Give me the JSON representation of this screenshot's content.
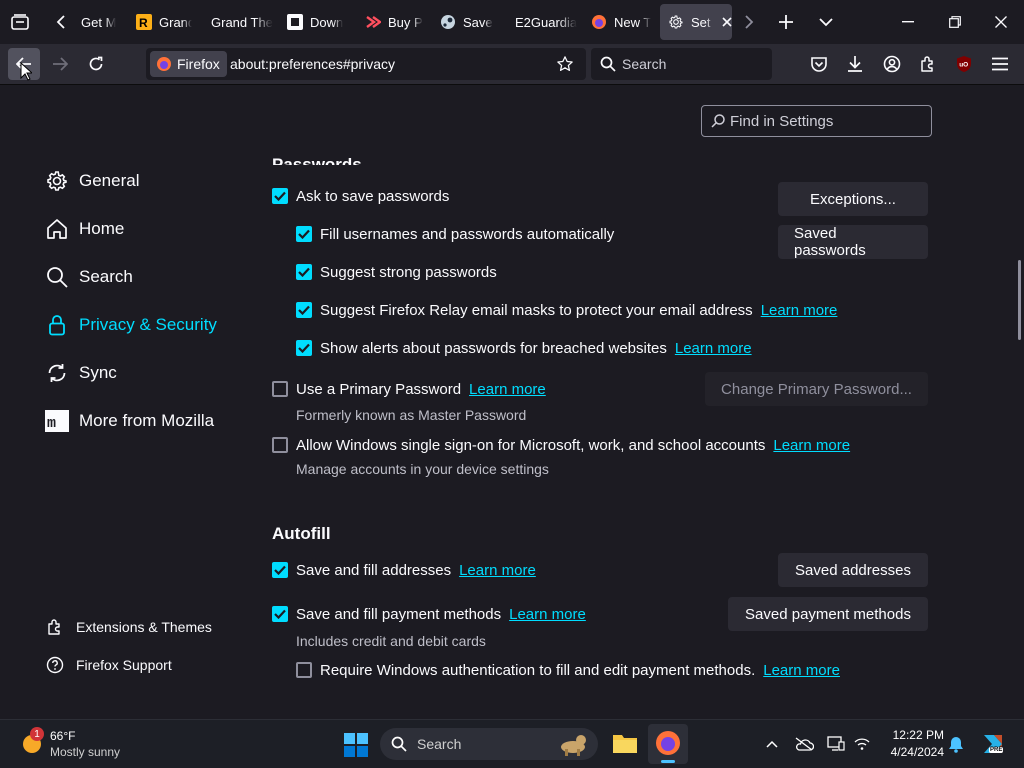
{
  "tabs": [
    {
      "title": "Get M",
      "icon": "mozilla-icon"
    },
    {
      "title": "Grand",
      "icon": "rockstar-icon"
    },
    {
      "title": "Grand The",
      "icon": "generic-page-icon"
    },
    {
      "title": "Down",
      "icon": "puzzle-site-icon"
    },
    {
      "title": "Buy P",
      "icon": "buy-site-icon"
    },
    {
      "title": "Save ",
      "icon": "steam-icon"
    },
    {
      "title": "E2Guardia",
      "icon": "generic-page-icon"
    },
    {
      "title": "New T",
      "icon": "firefox-icon"
    },
    {
      "title": "Set",
      "icon": "gear-icon",
      "active": true
    }
  ],
  "navbar": {
    "identity_label": "Firefox",
    "url": "about:preferences#privacy",
    "search_placeholder": "Search"
  },
  "find_placeholder": "Find in Settings",
  "categories": [
    {
      "label": "General",
      "icon": "gear-icon"
    },
    {
      "label": "Home",
      "icon": "home-icon"
    },
    {
      "label": "Search",
      "icon": "search-icon"
    },
    {
      "label": "Privacy & Security",
      "icon": "lock-icon",
      "selected": true
    },
    {
      "label": "Sync",
      "icon": "sync-icon"
    },
    {
      "label": "More from Mozilla",
      "icon": "mozilla-icon"
    }
  ],
  "footer": {
    "extensions": "Extensions & Themes",
    "support": "Firefox Support"
  },
  "passwords": {
    "heading": "Passwords",
    "ask_save": "Ask to save passwords",
    "fill_auto": "Fill usernames and passwords automatically",
    "suggest_strong": "Suggest strong passwords",
    "relay": "Suggest Firefox Relay email masks to protect your email address",
    "alerts": "Show alerts about passwords for breached websites",
    "primary": "Use a Primary Password",
    "primary_sub": "Formerly known as Master Password",
    "sso": "Allow Windows single sign-on for Microsoft, work, and school accounts",
    "sso_sub": "Manage accounts in your device settings",
    "exceptions_btn": "Exceptions...",
    "saved_btn": "Saved passwords",
    "change_primary_btn": "Change Primary Password...",
    "learn_more": "Learn more"
  },
  "autofill": {
    "heading": "Autofill",
    "addresses": "Save and fill addresses",
    "payments": "Save and fill payment methods",
    "payments_sub": "Includes credit and debit cards",
    "require_auth": "Require Windows authentication to fill and edit payment methods.",
    "saved_addresses_btn": "Saved addresses",
    "saved_payments_btn": "Saved payment methods",
    "learn_more": "Learn more"
  },
  "taskbar": {
    "weather_temp": "66°F",
    "weather_desc": "Mostly sunny",
    "weather_badge": "1",
    "search_label": "Search",
    "time": "12:22 PM",
    "date": "4/24/2024",
    "copilot_badge": "PRE"
  },
  "colors": {
    "accent": "#00ddff",
    "background": "#1c1b22",
    "toolbar": "#2b2a33",
    "button": "#2b2a33"
  }
}
